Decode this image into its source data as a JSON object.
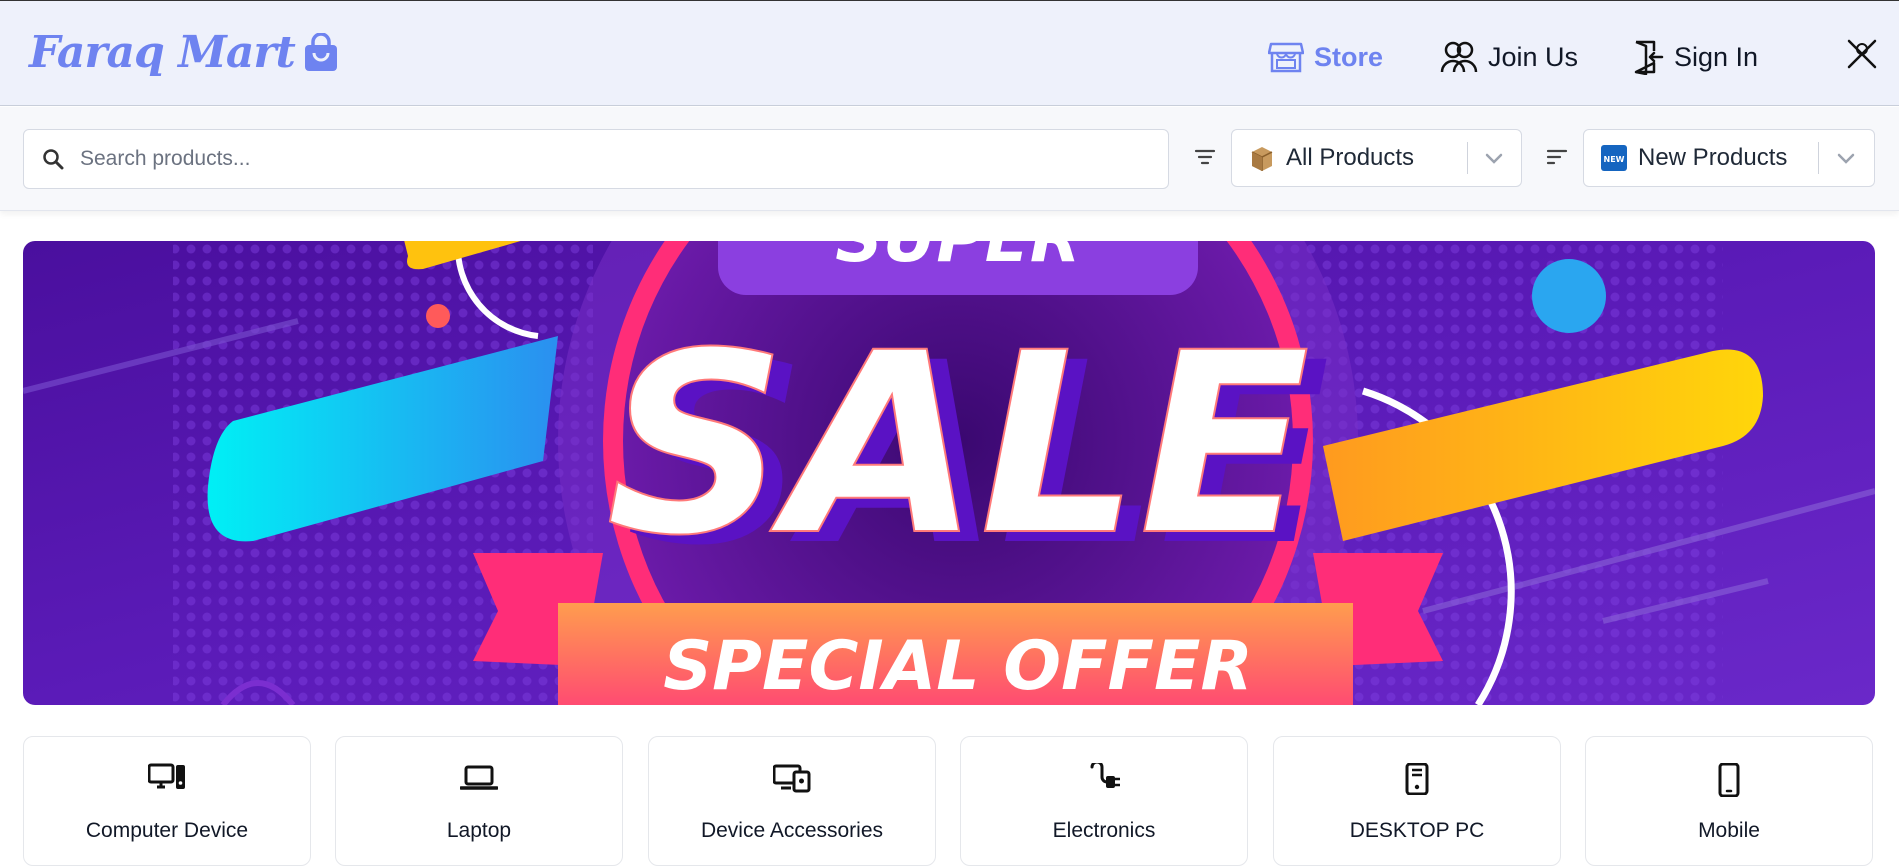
{
  "brand": {
    "name": "Faraq Mart",
    "accent": "#6e83f0"
  },
  "nav": {
    "store": "Store",
    "join": "Join Us",
    "sign_in": "Sign In",
    "icons": [
      "store-icon",
      "users-icon",
      "sign-in-icon",
      "close-icon"
    ]
  },
  "search": {
    "placeholder": "Search products..."
  },
  "filters": {
    "category": {
      "value": "All Products",
      "icon": "box-icon"
    },
    "sort": {
      "value": "New Products",
      "icon": "new-badge-icon"
    }
  },
  "banner": {
    "top_text": "SUPER",
    "main_text": "SALE",
    "sub_text": "SPECIAL OFFER",
    "colors": {
      "bg": "#5b1bb8",
      "ribbon": "#ff4f7a",
      "orange": "#ffa54d",
      "cyan": "#19d8f5",
      "yellow": "#ffc20e"
    }
  },
  "categories": [
    {
      "label": "Computer Device",
      "icon": "computer-icon"
    },
    {
      "label": "Laptop",
      "icon": "laptop-icon"
    },
    {
      "label": "Device Accessories",
      "icon": "devices-icon"
    },
    {
      "label": "Electronics",
      "icon": "plug-icon"
    },
    {
      "label": "DESKTOP PC",
      "icon": "pc-tower-icon"
    },
    {
      "label": "Mobile",
      "icon": "mobile-icon"
    }
  ]
}
